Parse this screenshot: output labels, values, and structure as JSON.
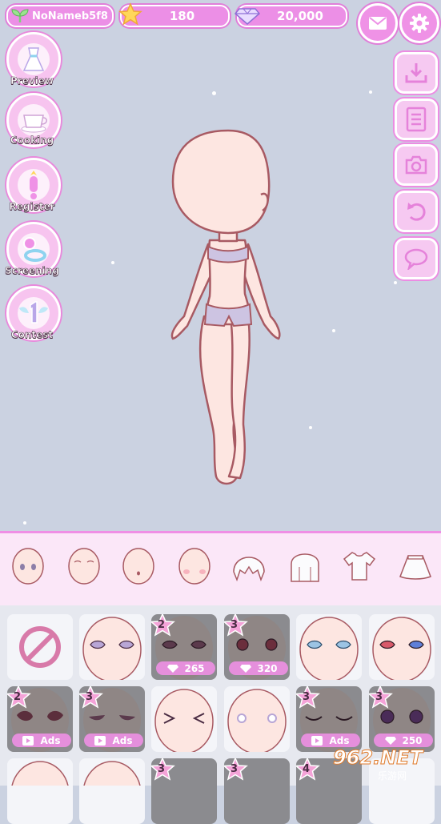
{
  "header": {
    "username": "NoNameb5f8",
    "stars": "180",
    "gems": "20,000",
    "mail_icon": "mail-icon",
    "settings_icon": "gear-icon"
  },
  "left_menu": [
    {
      "label": "Preview",
      "icon": "dress-icon"
    },
    {
      "label": "Cooking",
      "icon": "teacup-icon"
    },
    {
      "label": "Register",
      "icon": "exclamation-icon"
    },
    {
      "label": "Screening",
      "icon": "ring-icon"
    },
    {
      "label": "Contest",
      "icon": "winged-one-icon"
    }
  ],
  "right_menu": [
    "download-icon",
    "notes-icon",
    "camera-icon",
    "undo-icon",
    "chat-bubble-icon"
  ],
  "tabs": [
    "face-eyes-tab",
    "face-blank-tab",
    "face-mouth-tab",
    "face-blush-tab",
    "hair-front-tab",
    "hair-back-tab",
    "shirt-tab",
    "skirt-tab"
  ],
  "grid": {
    "row1": [
      {
        "type": "none"
      },
      {
        "type": "eyes-purple"
      },
      {
        "type": "locked",
        "star": "2",
        "price": "265"
      },
      {
        "type": "locked",
        "star": "3",
        "price": "320"
      },
      {
        "type": "eyes-blue"
      },
      {
        "type": "eyes-red"
      }
    ],
    "row2": [
      {
        "type": "locked",
        "star": "2",
        "price": "Ads"
      },
      {
        "type": "locked",
        "star": "3",
        "price": "Ads"
      },
      {
        "type": "eyes-closed"
      },
      {
        "type": "eyes-dots"
      },
      {
        "type": "locked",
        "star": "3",
        "price": "Ads"
      },
      {
        "type": "locked",
        "star": "3",
        "price": "250"
      }
    ],
    "row3_stars": [
      "3",
      "3",
      "4"
    ]
  },
  "watermark": {
    "brand": "962.NET",
    "sub": "乐游网"
  },
  "colors": {
    "accent": "#ec8fe6",
    "background": "#cbd2e1",
    "skin": "#fde6e1",
    "outline": "#a85a63"
  }
}
